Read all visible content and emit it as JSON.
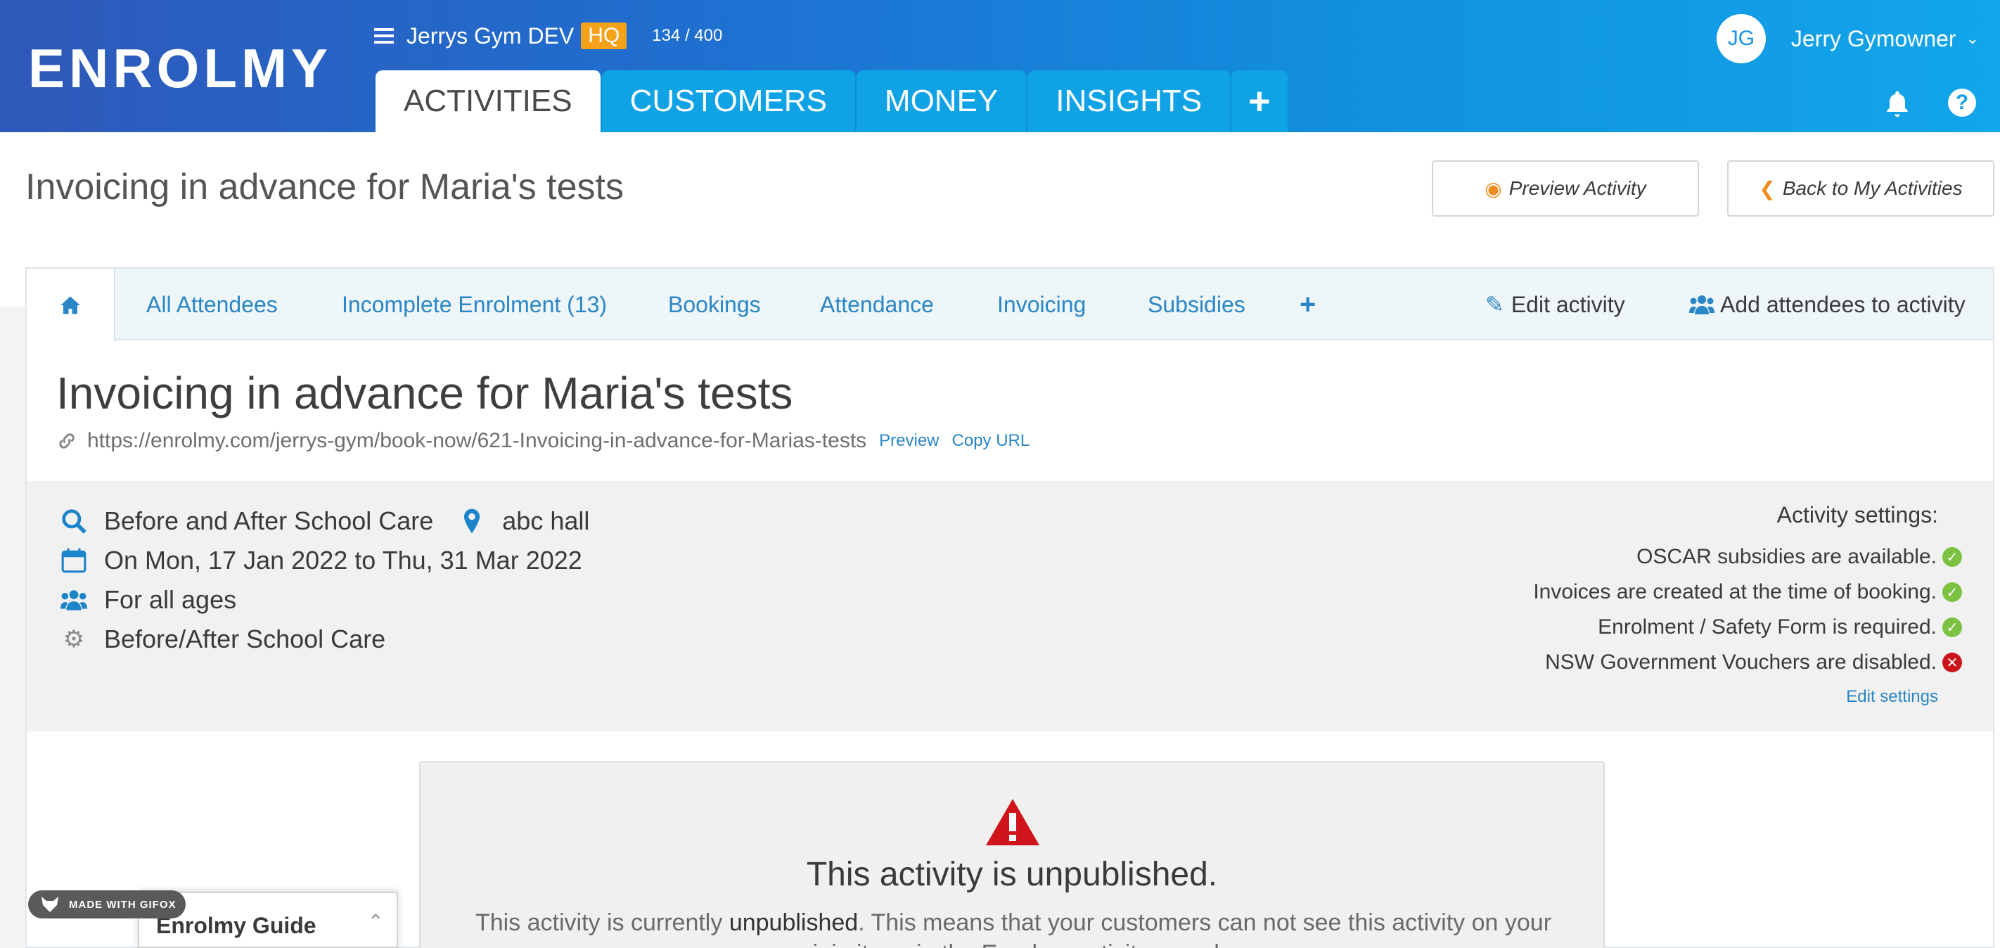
{
  "brand": {
    "logo": "ENROLMY"
  },
  "org": {
    "name": "Jerrys Gym DEV",
    "badge": "HQ",
    "count": "134 / 400"
  },
  "main_tabs": [
    {
      "label": "ACTIVITIES",
      "active": true
    },
    {
      "label": "CUSTOMERS"
    },
    {
      "label": "MONEY"
    },
    {
      "label": "INSIGHTS"
    },
    {
      "label": "+"
    }
  ],
  "user": {
    "initials": "JG",
    "name": "Jerry Gymowner"
  },
  "page": {
    "title": "Invoicing in advance for Maria's tests",
    "preview_button": "Preview Activity",
    "back_button": "Back to My Activities"
  },
  "subtabs": {
    "items": [
      "All Attendees",
      "Incomplete Enrolment (13)",
      "Bookings",
      "Attendance",
      "Invoicing",
      "Subsidies",
      "+"
    ],
    "edit": "Edit activity",
    "add": "Add attendees to activity"
  },
  "activity": {
    "title": "Invoicing in advance for Maria's tests",
    "url": "https://enrolmy.com/jerrys-gym/book-now/621-Invoicing-in-advance-for-Marias-tests",
    "preview_link": "Preview",
    "copy_link": "Copy URL",
    "category": "Before and After School Care",
    "location": "abc hall",
    "dates": "On Mon, 17 Jan 2022 to Thu, 31 Mar 2022",
    "ages": "For all ages",
    "type": "Before/After School Care"
  },
  "settings": {
    "heading": "Activity settings:",
    "rows": [
      {
        "text": "OSCAR subsidies are available.",
        "status": "ok"
      },
      {
        "text": "Invoices are created at the time of booking.",
        "status": "ok"
      },
      {
        "text": "Enrolment / Safety Form is required.",
        "status": "ok"
      },
      {
        "text": "NSW Government Vouchers are disabled.",
        "status": "bad"
      }
    ],
    "edit_link": "Edit settings"
  },
  "unpublished": {
    "title": "This activity is unpublished.",
    "text_a": "This activity is currently ",
    "text_b": "unpublished",
    "text_c": ". This means that your customers can not see this activity on your mini-site or in the Enrolmy activity search."
  },
  "guide": {
    "label": "Enrolmy Guide"
  },
  "watermark": {
    "label": "MADE WITH GIFOX"
  },
  "colors": {
    "brand_blue": "#1993dd",
    "hq_orange": "#f4a21a",
    "ok_green": "#7cc242",
    "error_red": "#c9151b",
    "link_blue": "#2a86c6"
  }
}
